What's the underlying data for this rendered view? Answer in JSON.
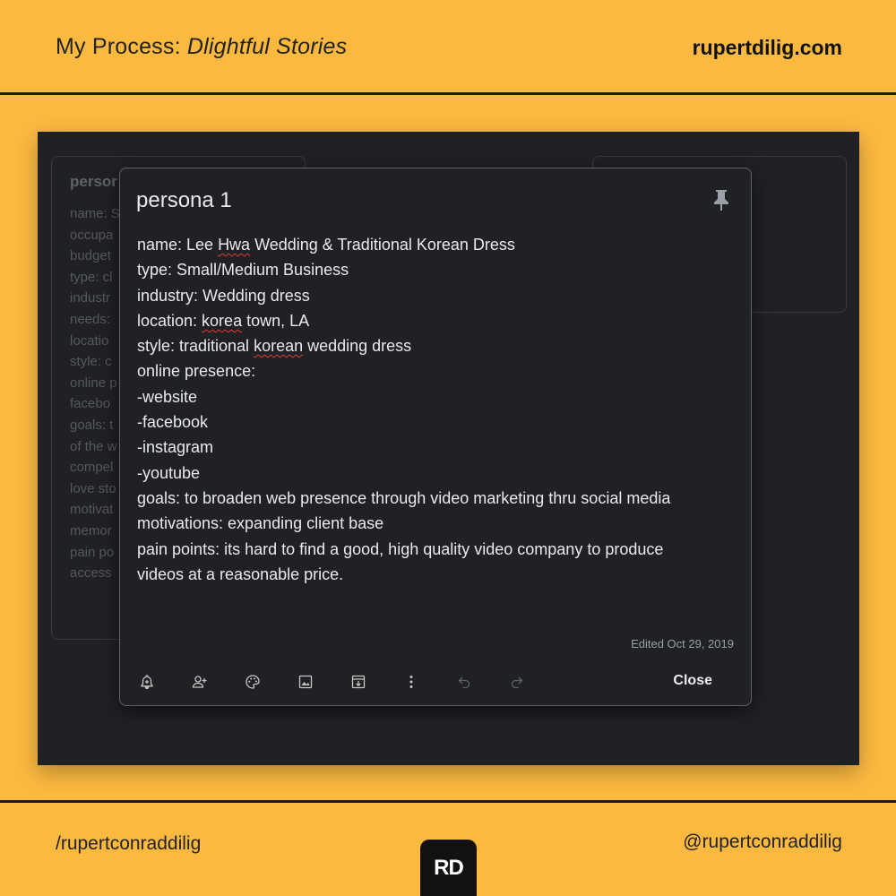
{
  "header": {
    "title_prefix": "My Process: ",
    "title_italic": "Dlightful Stories",
    "site": "rupertdilig.com"
  },
  "background_cards": {
    "left": {
      "title": "persor",
      "lines": [
        "name: S",
        "occupa",
        "budget",
        "type: cl",
        "industr",
        "needs: ",
        "locatio",
        "style: c",
        "online p",
        "facebo",
        "goals: t",
        "of the w",
        "compel",
        "love sto",
        "motivat",
        "memor",
        "pain po",
        "access"
      ]
    }
  },
  "note": {
    "title": "persona 1",
    "line_name_prefix": "name: Lee ",
    "line_name_hwa": "Hwa",
    "line_name_suffix": " Wedding & Traditional Korean Dress",
    "line_type": "type: Small/Medium Business",
    "line_industry": "industry: Wedding dress",
    "line_location_prefix": "location: ",
    "line_location_korea": "korea",
    "line_location_suffix": " town, LA",
    "line_style_prefix": "style: traditional ",
    "line_style_korean": "korean",
    "line_style_suffix": " wedding dress",
    "line_presence": "online presence:",
    "line_website": " -website",
    "line_facebook": " -facebook",
    "line_instagram": " -instagram",
    "line_youtube": " -youtube",
    "line_goals": "goals: to broaden web presence through video marketing thru social media",
    "line_motivations": "motivations: expanding client base",
    "line_pain1": "pain points: its hard to find a good, high quality video company to produce",
    "line_pain2": "videos at a reasonable price.",
    "edited": "Edited Oct 29, 2019",
    "close_label": "Close",
    "toolbar_icons": [
      "reminder-icon",
      "collaborator-icon",
      "palette-icon",
      "image-icon",
      "archive-icon",
      "more-icon",
      "undo-icon",
      "redo-icon"
    ]
  },
  "footer": {
    "left": "/rupertconraddilig",
    "right": "@rupertconraddilig",
    "logo": "RD"
  },
  "colors": {
    "background": "#fbb940",
    "panel": "#202124",
    "text_light": "#e8eaed",
    "muted": "#9aa0a6",
    "spell_underline": "#e53935"
  }
}
